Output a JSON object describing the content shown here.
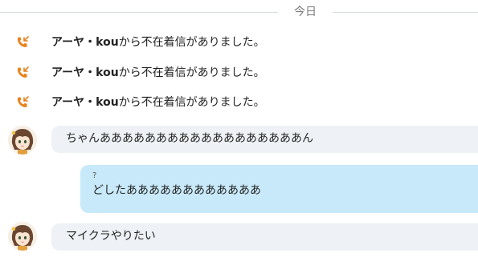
{
  "date_divider": {
    "label": "今日"
  },
  "missed_calls": [
    {
      "name": "アーヤ・kou",
      "suffix": "から不在着信がありました。"
    },
    {
      "name": "アーヤ・kou",
      "suffix": "から不在着信がありました。"
    },
    {
      "name": "アーヤ・kou",
      "suffix": "から不在着信がありました。"
    }
  ],
  "messages": [
    {
      "direction": "incoming",
      "text": "ちゃんああああああああああああああああああん"
    },
    {
      "direction": "outgoing",
      "prefix": "?",
      "text": "どしたああああああああああああ"
    },
    {
      "direction": "incoming",
      "text": "マイクラやりたい"
    }
  ],
  "colors": {
    "missed_call_icon": "#e8821e",
    "incoming_bubble": "#eef2f6",
    "outgoing_bubble": "#c8e9f9",
    "divider_line": "#d6dde3"
  }
}
